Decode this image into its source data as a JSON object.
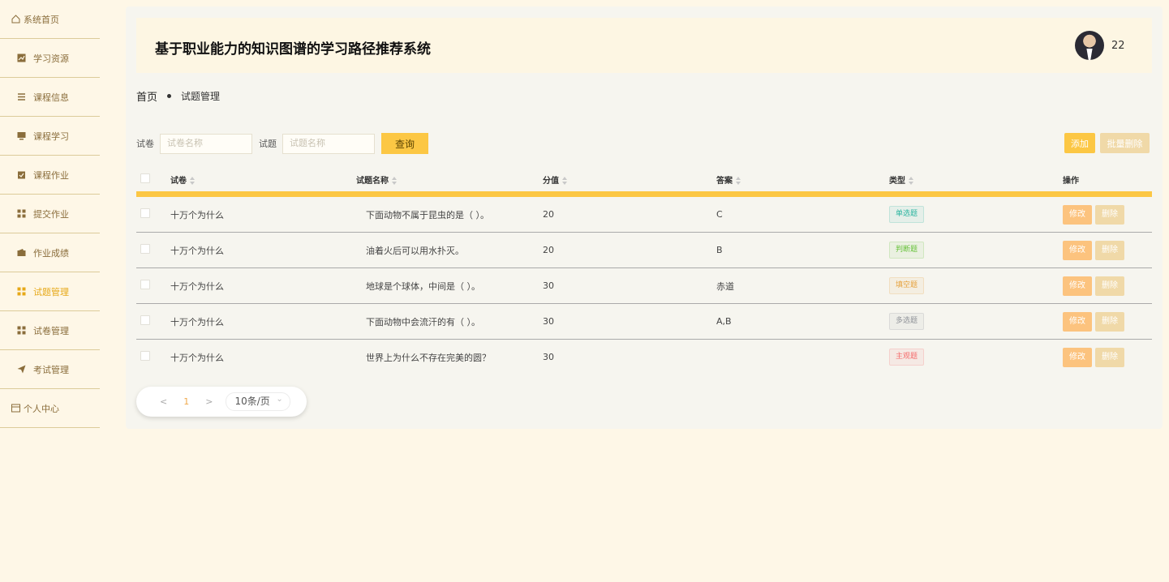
{
  "sidebar": {
    "items": [
      {
        "label": "系统首页",
        "icon": "home-icon"
      },
      {
        "label": "学习资源",
        "icon": "chart-icon"
      },
      {
        "label": "课程信息",
        "icon": "list-icon"
      },
      {
        "label": "课程学习",
        "icon": "monitor-icon"
      },
      {
        "label": "课程作业",
        "icon": "clipboard-icon"
      },
      {
        "label": "提交作业",
        "icon": "grid-icon"
      },
      {
        "label": "作业成绩",
        "icon": "wallet-icon"
      },
      {
        "label": "试题管理",
        "icon": "grid-icon"
      },
      {
        "label": "试卷管理",
        "icon": "grid-icon"
      },
      {
        "label": "考试管理",
        "icon": "send-icon"
      },
      {
        "label": "个人中心",
        "icon": "card-icon"
      }
    ],
    "active_index": 7
  },
  "header": {
    "title": "基于职业能力的知识图谱的学习路径推荐系统",
    "username": "22"
  },
  "breadcrumb": {
    "home": "首页",
    "current": "试题管理"
  },
  "search": {
    "paper_label": "试卷",
    "paper_placeholder": "试卷名称",
    "question_label": "试题",
    "question_placeholder": "试题名称",
    "query_button": "查询"
  },
  "actions": {
    "add": "添加",
    "batch_delete": "批量删除"
  },
  "table": {
    "columns": [
      "试卷",
      "试题名称",
      "分值",
      "答案",
      "类型",
      "操作"
    ],
    "rows": [
      {
        "paper": "十万个为什么",
        "question": "下面动物不属于昆虫的是（ ）。",
        "score": "20",
        "answer": "C",
        "type": "单选题",
        "type_color": "#2bb5a0"
      },
      {
        "paper": "十万个为什么",
        "question": "油着火后可以用水扑灭。",
        "score": "20",
        "answer": "B",
        "type": "判断题",
        "type_color": "#67c23a"
      },
      {
        "paper": "十万个为什么",
        "question": "地球是个球体，中间是（ ）。",
        "score": "30",
        "answer": "赤道",
        "type": "填空题",
        "type_color": "#e6a23c"
      },
      {
        "paper": "十万个为什么",
        "question": "下面动物中会流汗的有（ ）。",
        "score": "30",
        "answer": "A,B",
        "type": "多选题",
        "type_color": "#909399"
      },
      {
        "paper": "十万个为什么",
        "question": "世界上为什么不存在完美的圆？",
        "score": "30",
        "answer": "",
        "type": "主观题",
        "type_color": "#f56c6c"
      }
    ],
    "edit_label": "修改",
    "delete_label": "删除"
  },
  "pagination": {
    "prev": "<",
    "page": "1",
    "next": ">",
    "page_size": "10条/页"
  }
}
